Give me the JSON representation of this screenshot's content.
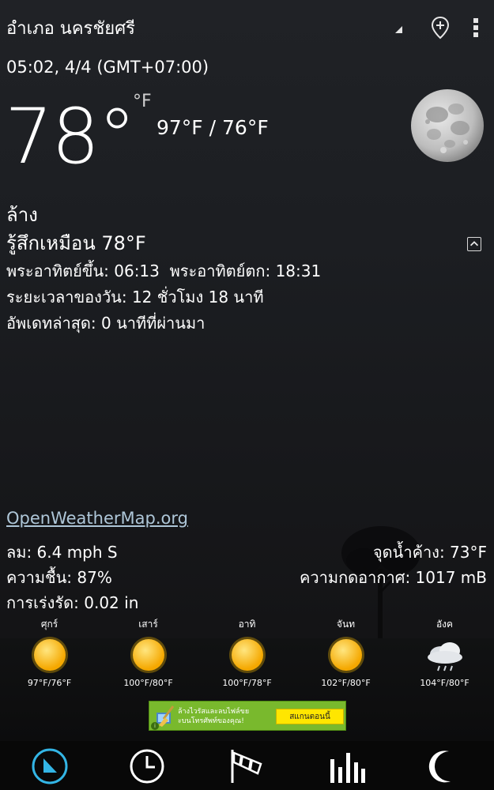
{
  "header": {
    "location": "อำเภอ นครชัยศรี",
    "icons": [
      "dropdown-triangle-icon",
      "add-location-pin-icon",
      "more-vert-icon"
    ]
  },
  "current": {
    "datetime": "05:02, 4/4 (GMT+07:00)",
    "temperature": "78°",
    "unit": "°F",
    "high_low": "97°F / 76°F",
    "condition": "ล้าง",
    "feels_like": "รู้สึกเหมือน 78°F",
    "sun": "พระอาทิตย์ขึ้น: 06:13  พระอาทิตย์ตก: 18:31",
    "day_length": "ระยะเวลาของวัน: 12 ชั่วโมง 18 นาที",
    "updated": "อัพเดทล่าสุด: 0 นาทีที่ผ่านมา"
  },
  "source_link": "OpenWeatherMap.org",
  "details": {
    "wind": "ลม: 6.4 mph S",
    "humidity": "ความชื้น: 87%",
    "precipitation": "การเร่งรัด: 0.02 in",
    "dew_point": "จุดน้ำค้าง: 73°F",
    "pressure": "ความกดอากาศ: 1017 mB"
  },
  "forecast": [
    {
      "day": "ศุกร์",
      "range": "97°F/76°F",
      "icon": "sun-icon"
    },
    {
      "day": "เสาร์",
      "range": "100°F/80°F",
      "icon": "sun-icon"
    },
    {
      "day": "อาทิ",
      "range": "100°F/78°F",
      "icon": "sun-icon"
    },
    {
      "day": "จันท",
      "range": "102°F/80°F",
      "icon": "sun-icon"
    },
    {
      "day": "อังค",
      "range": "104°F/80°F",
      "icon": "rain-cloud-icon"
    }
  ],
  "ad": {
    "text_line1": "ล้างไวรัสและลบไฟล์ขย",
    "text_line2": "ะบนโทรศัพท์ของคุณ!",
    "button": "สแกนตอนนี้"
  },
  "nav": {
    "items": [
      "weather-clock-icon",
      "history-clock-icon",
      "wind-sock-icon",
      "chart-bars-icon",
      "moon-phase-icon"
    ],
    "active": 0,
    "accent": "#33b5e5"
  }
}
